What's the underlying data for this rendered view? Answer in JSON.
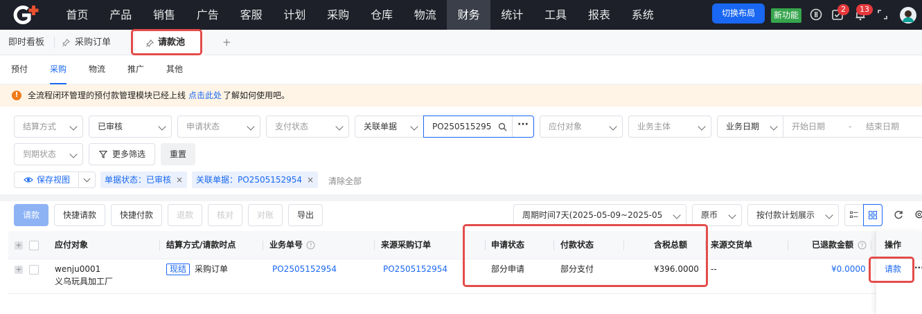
{
  "nav": {
    "items": [
      "首页",
      "产品",
      "销售",
      "广告",
      "客服",
      "计划",
      "采购",
      "仓库",
      "物流",
      "财务",
      "统计",
      "工具",
      "报表",
      "系统"
    ],
    "active_index": 9,
    "switch_layout": "切换布局",
    "new_feature": "新功能",
    "task_badge": "2",
    "notif_badge": "13"
  },
  "page_tabs": {
    "dashboard": "即时看板",
    "purchase_order": "采购订单",
    "request_pool": "请款池",
    "add": "+"
  },
  "sub_tabs": [
    "预付",
    "采购",
    "物流",
    "推广",
    "其他"
  ],
  "sub_tabs_active": 1,
  "notice": {
    "text": "全流程闭环管理的预付款管理模块已经上线",
    "link": "点击此处",
    "suffix": "了解如何使用吧。"
  },
  "filters": {
    "settlement": "结算方式",
    "audit": "已审核",
    "apply_status": "申请状态",
    "pay_status": "支付状态",
    "related_doc": "关联单据",
    "search_value": "PO2505152954",
    "payee": "应付对象",
    "entity": "业务主体",
    "biz_date": "业务日期",
    "start_date": "开始日期",
    "date_sep": "-",
    "end_date": "结束日期",
    "due_status": "到期状态",
    "more_filters": "更多筛选",
    "reset": "重置"
  },
  "view": {
    "save_view": "保存视图",
    "chip_status": "单据状态：已审核",
    "chip_doc": "关联单据：PO2505152954",
    "clear_all": "清除全部"
  },
  "toolbar": {
    "request": "请款",
    "quick_request": "快捷请款",
    "quick_pay": "快捷付款",
    "refund": "退款",
    "verify": "核对",
    "reconcile": "对账",
    "export": "导出",
    "period": "周期时间7天(2025-05-09~2025-05",
    "currency": "原币",
    "display_mode": "按付款计划展示"
  },
  "table": {
    "headers": {
      "payee": "应付对象",
      "settlement": "结算方式/请款时点",
      "biz_no": "业务单号",
      "source_po": "来源采购订单",
      "apply_status": "申请状态",
      "pay_status": "付款状态",
      "amount": "含税总额",
      "source_delivery": "来源交货单",
      "refunded": "已退款金额",
      "action": "操作"
    },
    "rows": [
      {
        "payee_id": "wenju0001",
        "payee_name": "义乌玩具加工厂",
        "settle_tag": "现结",
        "settle_point": "采购订单",
        "biz_no": "PO2505152954",
        "source_po": "PO2505152954",
        "apply_status": "部分申请",
        "pay_status": "部分支付",
        "amount": "¥396.0000",
        "source_delivery": "--",
        "refunded": "¥0.0000",
        "action": "请款",
        "more": "···"
      }
    ]
  }
}
